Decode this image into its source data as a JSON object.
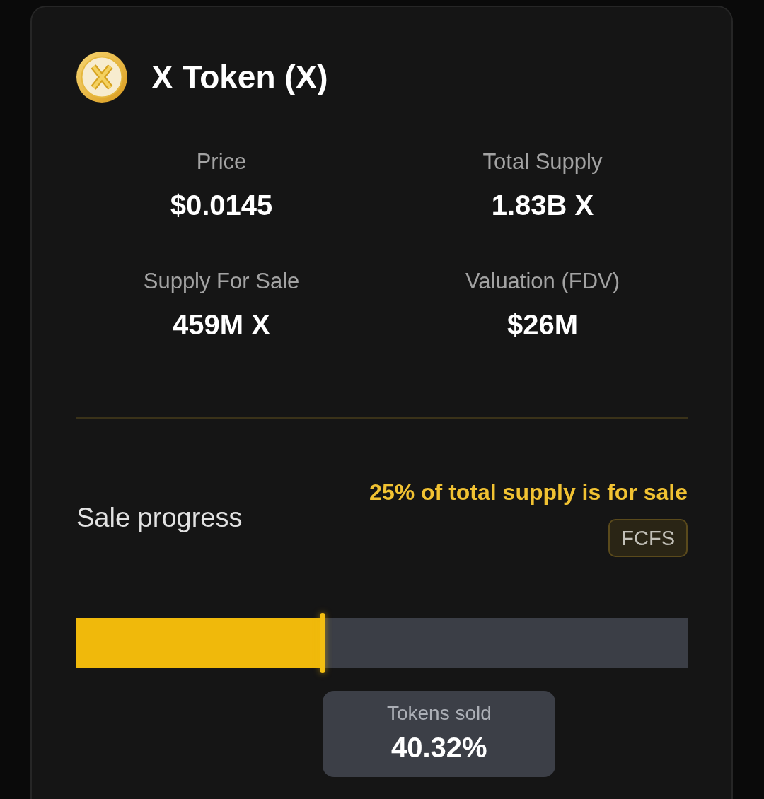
{
  "token": {
    "name": "X Token (X)"
  },
  "stats": [
    {
      "label": "Price",
      "value": "$0.0145"
    },
    {
      "label": "Total Supply",
      "value": "1.83B X"
    },
    {
      "label": "Supply For Sale",
      "value": "459M X"
    },
    {
      "label": "Valuation (FDV)",
      "value": "$26M"
    }
  ],
  "sale": {
    "title": "Sale progress",
    "note": "25% of total supply is for sale",
    "badge": "FCFS"
  },
  "progress": {
    "level": 0.4032,
    "tooltip_label": "Tokens sold",
    "reading": "40.32%"
  }
}
